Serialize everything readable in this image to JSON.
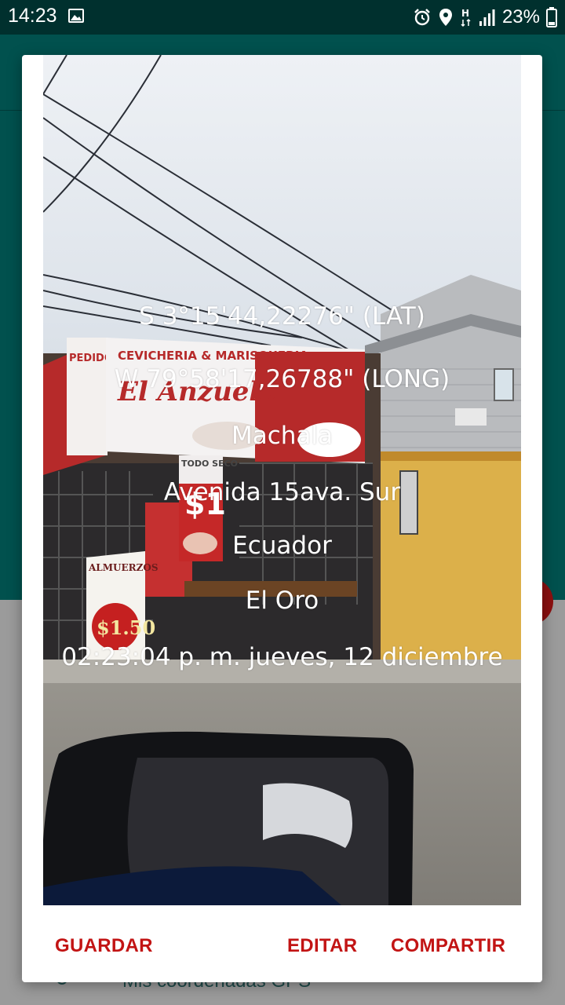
{
  "status_bar": {
    "time": "14:23",
    "battery": "23%",
    "icons": [
      "image-icon",
      "alarm-icon",
      "location-icon",
      "network-h-icon",
      "signal-icon",
      "battery-icon"
    ]
  },
  "background_app": {
    "list_item_label": "Mis coordenadas GPS",
    "header_color": "#01514e",
    "fab_color": "#8c1010"
  },
  "photo_overlay": {
    "latitude": "S 3°15'44,22276\" (LAT)",
    "longitude": "W 79°58'17,26788\" (LONG)",
    "city": "Machala",
    "street": "Avenida 15ava. Sur",
    "country": "Ecuador",
    "province": "El Oro",
    "datetime": "02:23:04 p. m. jueves, 12 diciembre"
  },
  "scene_text": {
    "shop_sign_top": "CEVICHERIA & MARISQUERIA",
    "shop_name": "El Anzuelo",
    "pedidos": "PEDIDOS",
    "todo_seco": "TODO SECO",
    "price_1": "$1",
    "almuerzos": "ALMUERZOS",
    "almuerzos_price": "$1.50"
  },
  "actions": {
    "save": "GUARDAR",
    "edit": "EDITAR",
    "share": "COMPARTIR"
  },
  "colors": {
    "accent": "#c21414",
    "status_bar": "#00302e"
  }
}
